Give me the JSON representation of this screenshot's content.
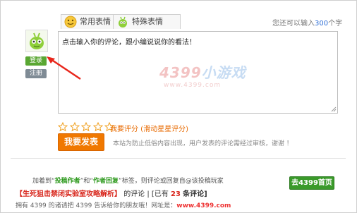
{
  "tabs": [
    {
      "label": "常用表情",
      "icon": "smiley-face-icon"
    },
    {
      "label": "特殊表情",
      "icon": "green-mascot-icon"
    }
  ],
  "counter": {
    "prefix": "您还可以输入",
    "value": "300",
    "suffix": "个字"
  },
  "comment": {
    "placeholder": "点击输入你的评论，跟小编说说你的看法！"
  },
  "watermark": {
    "brand_num": "4399",
    "brand_text": "小游戏",
    "url": "www.4399.com"
  },
  "user": {
    "login_label": "登录",
    "register_label": "注册"
  },
  "rating": {
    "label": "我要评分 (滑动星星评分)",
    "stars": 5
  },
  "submit": {
    "label": "我要发表"
  },
  "notice": "本站为防止低俗内容出现，用户发表的评论需经过审核，谢谢 ！",
  "footer": {
    "line1": {
      "pre": "加着到“",
      "tag1": "投稿作者",
      "mid": "”和“",
      "tag2": "作者回复",
      "post": "”标签，则评论或回复自@该投稿玩家"
    },
    "title": "【生死狙击禁闭实验室攻略解析】",
    "comment_text": "的评论 | [已有",
    "count": "23",
    "count_suffix": "条评论]",
    "line3_pre": "拥有 4399 的诸请把 4399 告诉给你的朋友哦！网址是：",
    "site": "www.4399.com",
    "go_home_label": "去4399首页"
  },
  "colors": {
    "accent_orange": "#f07800",
    "login_green": "#59a732",
    "link_blue": "#2f6fd6",
    "count_red": "#d8251b"
  }
}
